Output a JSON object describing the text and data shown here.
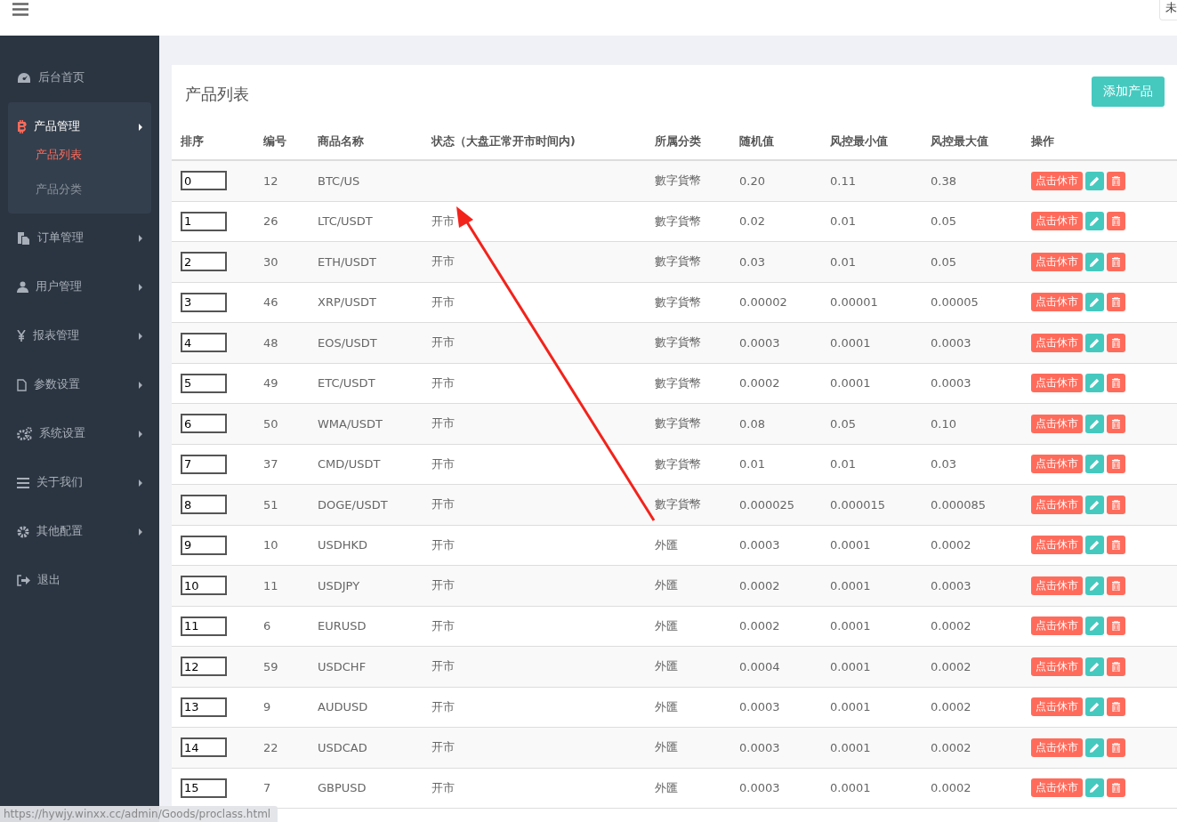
{
  "header": {
    "user_menu": "未"
  },
  "sidebar": {
    "items": [
      {
        "label": "后台首页",
        "kind": "link"
      },
      {
        "label": "产品管理",
        "kind": "menu",
        "expanded": true,
        "children": [
          {
            "label": "产品列表",
            "selected": true
          },
          {
            "label": "产品分类",
            "selected": false
          }
        ]
      },
      {
        "label": "订单管理",
        "kind": "menu",
        "expanded": false
      },
      {
        "label": "用户管理",
        "kind": "menu",
        "expanded": false
      },
      {
        "label": "报表管理",
        "kind": "menu",
        "expanded": false
      },
      {
        "label": "参数设置",
        "kind": "menu",
        "expanded": false
      },
      {
        "label": "系统设置",
        "kind": "menu",
        "expanded": false
      },
      {
        "label": "关于我们",
        "kind": "menu",
        "expanded": false
      },
      {
        "label": "其他配置",
        "kind": "menu",
        "expanded": false
      },
      {
        "label": "退出",
        "kind": "link"
      }
    ]
  },
  "card": {
    "title": "产品列表",
    "add_button": "添加产品"
  },
  "table": {
    "columns": [
      "排序",
      "编号",
      "商品名称",
      "状态（大盘正常开市时间内)",
      "所属分类",
      "随机值",
      "风控最小值",
      "风控最大值",
      "操作"
    ],
    "rows": [
      {
        "sort": "0",
        "id": "12",
        "name": "BTC/US",
        "category": "數字貨幣",
        "random": "0.20",
        "min": "0.11",
        "max": "0.38",
        "action": "点击休市"
      },
      {
        "sort": "1",
        "id": "26",
        "name": "LTC/USDT",
        "status": "开市",
        "category": "數字貨幣",
        "random": "0.02",
        "min": "0.01",
        "max": "0.05",
        "action": "点击休市"
      },
      {
        "sort": "2",
        "id": "30",
        "name": "ETH/USDT",
        "status": "开市",
        "category": "數字貨幣",
        "random": "0.03",
        "min": "0.01",
        "max": "0.05",
        "action": "点击休市"
      },
      {
        "sort": "3",
        "id": "46",
        "name": "XRP/USDT",
        "status": "开市",
        "category": "數字貨幣",
        "random": "0.00002",
        "min": "0.00001",
        "max": "0.00005",
        "action": "点击休市"
      },
      {
        "sort": "4",
        "id": "48",
        "name": "EOS/USDT",
        "status": "开市",
        "category": "數字貨幣",
        "random": "0.0003",
        "min": "0.0001",
        "max": "0.0003",
        "action": "点击休市"
      },
      {
        "sort": "5",
        "id": "49",
        "name": "ETC/USDT",
        "status": "开市",
        "category": "數字貨幣",
        "random": "0.0002",
        "min": "0.0001",
        "max": "0.0003",
        "action": "点击休市"
      },
      {
        "sort": "6",
        "id": "50",
        "name": "WMA/USDT",
        "status": "开市",
        "category": "數字貨幣",
        "random": "0.08",
        "min": "0.05",
        "max": "0.10",
        "action": "点击休市"
      },
      {
        "sort": "7",
        "id": "37",
        "name": "CMD/USDT",
        "status": "开市",
        "category": "數字貨幣",
        "random": "0.01",
        "min": "0.01",
        "max": "0.03",
        "action": "点击休市"
      },
      {
        "sort": "8",
        "id": "51",
        "name": "DOGE/USDT",
        "status": "开市",
        "category": "數字貨幣",
        "random": "0.000025",
        "min": "0.000015",
        "max": "0.000085",
        "action": "点击休市"
      },
      {
        "sort": "9",
        "id": "10",
        "name": "USDHKD",
        "status": "开市",
        "category": "外匯",
        "random": "0.0003",
        "min": "0.0001",
        "max": "0.0002",
        "action": "点击休市"
      },
      {
        "sort": "10",
        "id": "11",
        "name": "USDJPY",
        "status": "开市",
        "category": "外匯",
        "random": "0.0002",
        "min": "0.0001",
        "max": "0.0003",
        "action": "点击休市"
      },
      {
        "sort": "11",
        "id": "6",
        "name": "EURUSD",
        "status": "开市",
        "category": "外匯",
        "random": "0.0002",
        "min": "0.0001",
        "max": "0.0002",
        "action": "点击休市"
      },
      {
        "sort": "12",
        "id": "59",
        "name": "USDCHF",
        "status": "开市",
        "category": "外匯",
        "random": "0.0004",
        "min": "0.0001",
        "max": "0.0002",
        "action": "点击休市"
      },
      {
        "sort": "13",
        "id": "9",
        "name": "AUDUSD",
        "status": "开市",
        "category": "外匯",
        "random": "0.0003",
        "min": "0.0001",
        "max": "0.0002",
        "action": "点击休市"
      },
      {
        "sort": "14",
        "id": "22",
        "name": "USDCAD",
        "status": "开市",
        "category": "外匯",
        "random": "0.0003",
        "min": "0.0001",
        "max": "0.0002",
        "action": "点击休市"
      },
      {
        "sort": "15",
        "id": "7",
        "name": "GBPUSD",
        "status": "开市",
        "category": "外匯",
        "random": "0.0003",
        "min": "0.0001",
        "max": "0.0002",
        "action": "点击休市"
      }
    ]
  },
  "status_url": "https://hywjy.winxx.cc/admin/Goods/proclass.html"
}
